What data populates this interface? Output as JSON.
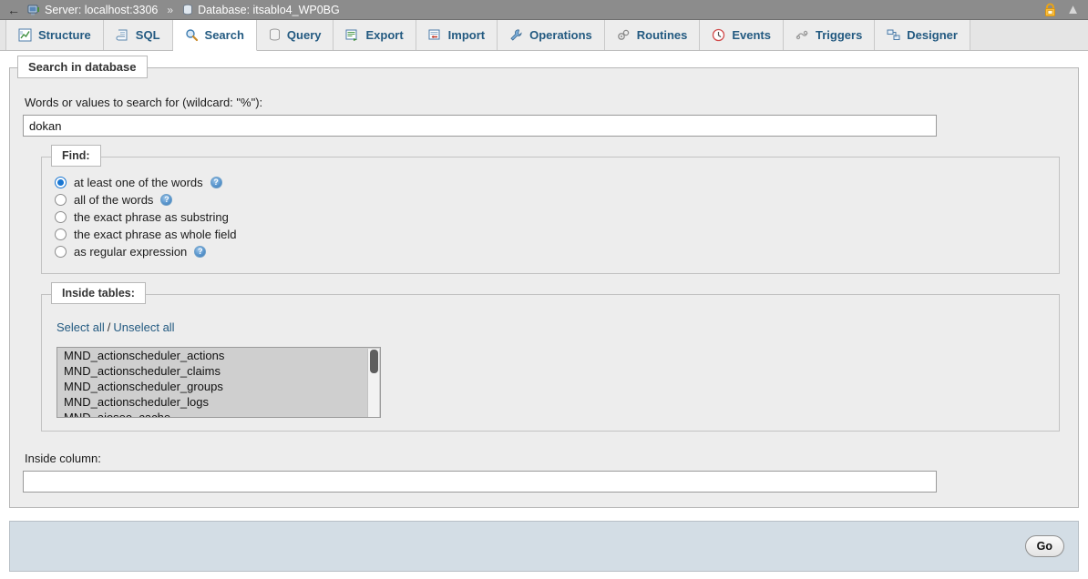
{
  "topbar": {
    "back_icon": "back-arrow-icon",
    "server_icon": "server-icon",
    "server_label": "Server: localhost:3306",
    "separator": "»",
    "database_icon": "database-icon",
    "database_label": "Database: itsablo4_WP0BG",
    "lock_icon": "lock-icon",
    "collapse_icon": "collapse-up-icon"
  },
  "tabs": [
    {
      "label": "Structure",
      "icon": "structure-icon",
      "active": false
    },
    {
      "label": "SQL",
      "icon": "sql-icon",
      "active": false
    },
    {
      "label": "Search",
      "icon": "search-icon",
      "active": true
    },
    {
      "label": "Query",
      "icon": "query-icon",
      "active": false
    },
    {
      "label": "Export",
      "icon": "export-icon",
      "active": false
    },
    {
      "label": "Import",
      "icon": "import-icon",
      "active": false
    },
    {
      "label": "Operations",
      "icon": "operations-icon",
      "active": false
    },
    {
      "label": "Routines",
      "icon": "routines-icon",
      "active": false
    },
    {
      "label": "Events",
      "icon": "events-icon",
      "active": false
    },
    {
      "label": "Triggers",
      "icon": "triggers-icon",
      "active": false
    },
    {
      "label": "Designer",
      "icon": "designer-icon",
      "active": false
    }
  ],
  "search_panel": {
    "legend": "Search in database",
    "words_label": "Words or values to search for (wildcard: \"%\"):",
    "words_value": "dokan",
    "words_placeholder": "",
    "find": {
      "legend": "Find:",
      "options": [
        {
          "label": "at least one of the words",
          "checked": true,
          "help": true
        },
        {
          "label": "all of the words",
          "checked": false,
          "help": true
        },
        {
          "label": "the exact phrase as substring",
          "checked": false,
          "help": false
        },
        {
          "label": "the exact phrase as whole field",
          "checked": false,
          "help": false
        },
        {
          "label": "as regular expression",
          "checked": false,
          "help": true
        }
      ],
      "help_glyph": "?"
    },
    "inside_tables": {
      "legend": "Inside tables:",
      "select_all": "Select all",
      "slash": "/",
      "unselect_all": "Unselect all",
      "tables": [
        "MND_actionscheduler_actions",
        "MND_actionscheduler_claims",
        "MND_actionscheduler_groups",
        "MND_actionscheduler_logs",
        "MND_aioseo_cache"
      ]
    },
    "inside_column_label": "Inside column:",
    "inside_column_value": "",
    "inside_column_placeholder": ""
  },
  "footer": {
    "go_label": "Go"
  }
}
